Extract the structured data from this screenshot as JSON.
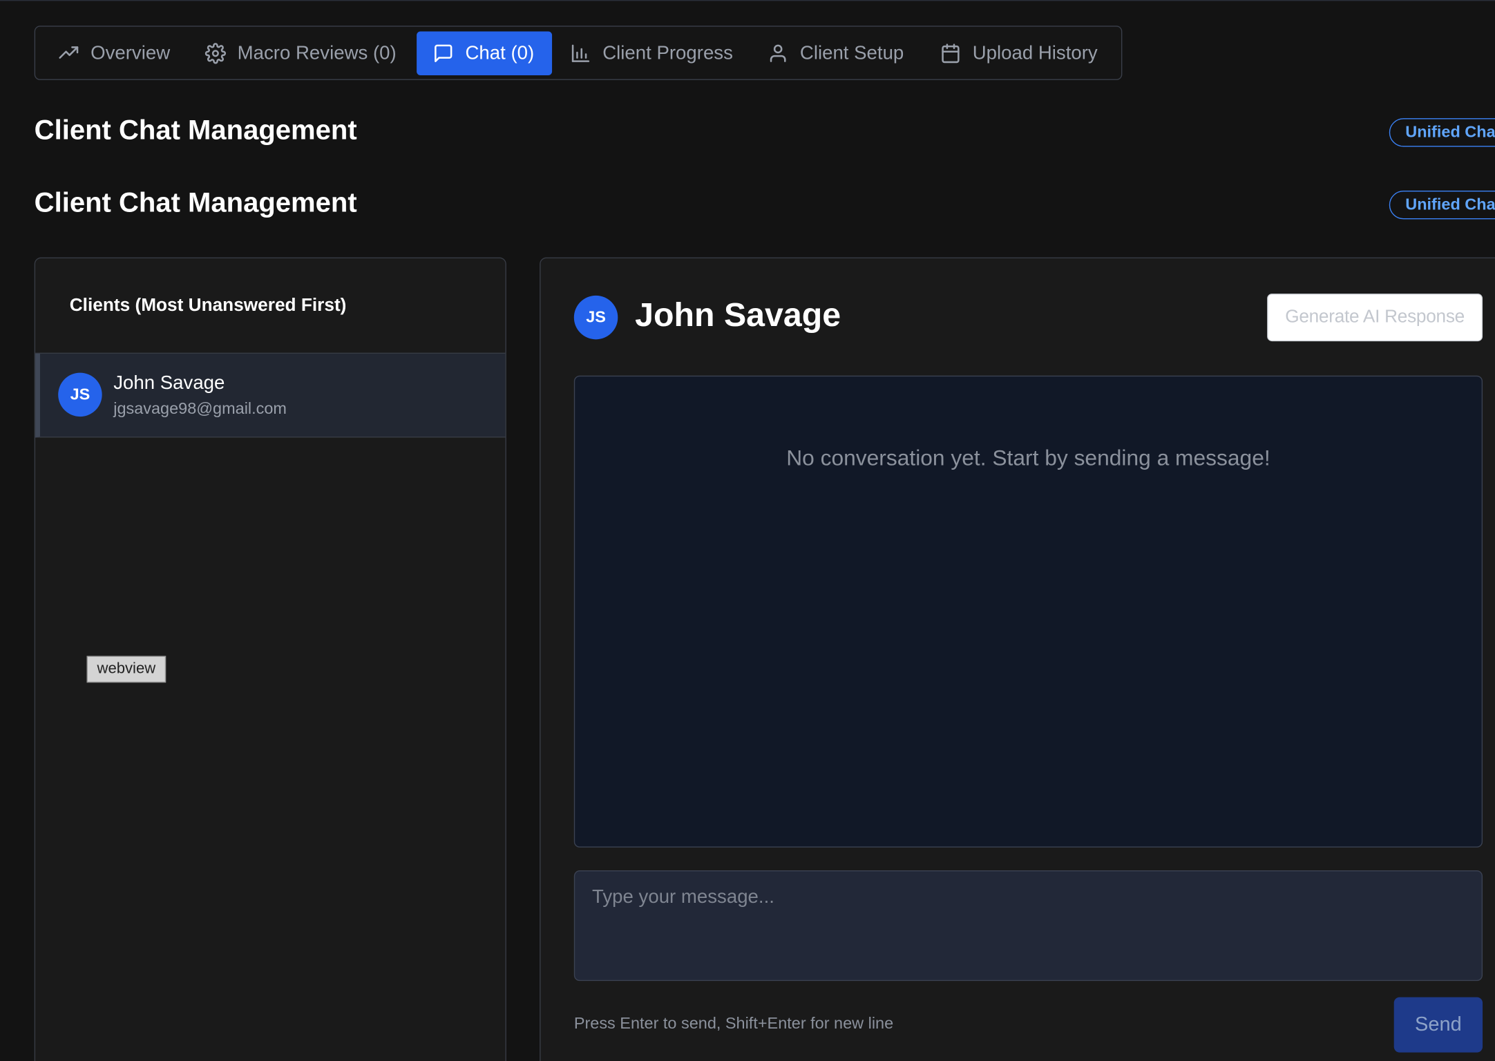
{
  "tabs": [
    {
      "label": "Overview",
      "icon": "trending-up-icon"
    },
    {
      "label": "Macro Reviews (0)",
      "icon": "gear-icon"
    },
    {
      "label": "Chat (0)",
      "icon": "chat-bubble-icon",
      "active": true
    },
    {
      "label": "Client Progress",
      "icon": "bar-chart-icon"
    },
    {
      "label": "Client Setup",
      "icon": "user-icon"
    },
    {
      "label": "Upload History",
      "icon": "calendar-icon"
    }
  ],
  "page": {
    "title": "Client Chat Management",
    "badge": "Unified Chat",
    "title_repeat": "Client Chat Management",
    "badge_repeat": "Unified Chat"
  },
  "clients": {
    "header": "Clients (Most Unanswered First)",
    "items": [
      {
        "initials": "JS",
        "name": "John Savage",
        "email": "jgsavage98@gmail.com"
      }
    ]
  },
  "overlay": {
    "webview_label": "webview"
  },
  "chat": {
    "initials": "JS",
    "client_name": "John Savage",
    "ai_button": "Generate AI Response",
    "empty_message": "No conversation yet. Start by sending a message!",
    "input_placeholder": "Type your message...",
    "input_value": "",
    "hint": "Press Enter to send, Shift+Enter for new line",
    "send_label": "Send"
  },
  "colors": {
    "accent": "#2563eb",
    "background": "#131313",
    "panel": "#1a1a1a",
    "conversation_bg": "#111827",
    "badge": "#60a5fa"
  }
}
